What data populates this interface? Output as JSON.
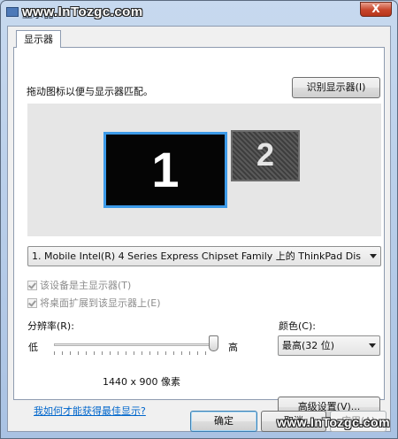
{
  "window": {
    "title": "显示器",
    "watermark": "www.InTozgc.com",
    "close_label": "X",
    "icons": {
      "title": "display-icon",
      "close": "close-icon"
    }
  },
  "tab": {
    "label": "显示器"
  },
  "instruction": "拖动图标以便与显示器匹配。",
  "identify_button": "识别显示器(I)",
  "monitors": [
    {
      "number": "1",
      "selected": true
    },
    {
      "number": "2",
      "selected": false
    }
  ],
  "display_select": {
    "value": "1. Mobile Intel(R) 4 Series Express Chipset Family 上的 ThinkPad Dis"
  },
  "checkboxes": [
    {
      "label": "该设备是主显示器(T)",
      "checked": true,
      "enabled": false
    },
    {
      "label": "将桌面扩展到该显示器上(E)",
      "checked": true,
      "enabled": false
    }
  ],
  "resolution": {
    "label": "分辨率(R):",
    "low": "低",
    "high": "高",
    "value": "1440 x 900 像素",
    "slider_level": 1.0
  },
  "color": {
    "label": "颜色(C):",
    "value": "最高(32 位)"
  },
  "help_link": "我如何才能获得最佳显示?",
  "advanced_button": "高级设置(V)...",
  "dialog_buttons": {
    "ok": "确定",
    "cancel": "取消",
    "apply": "应用(A)"
  },
  "colors": {
    "accent": "#3c9ae8",
    "link": "#0066cc",
    "close": "#c7452a"
  }
}
